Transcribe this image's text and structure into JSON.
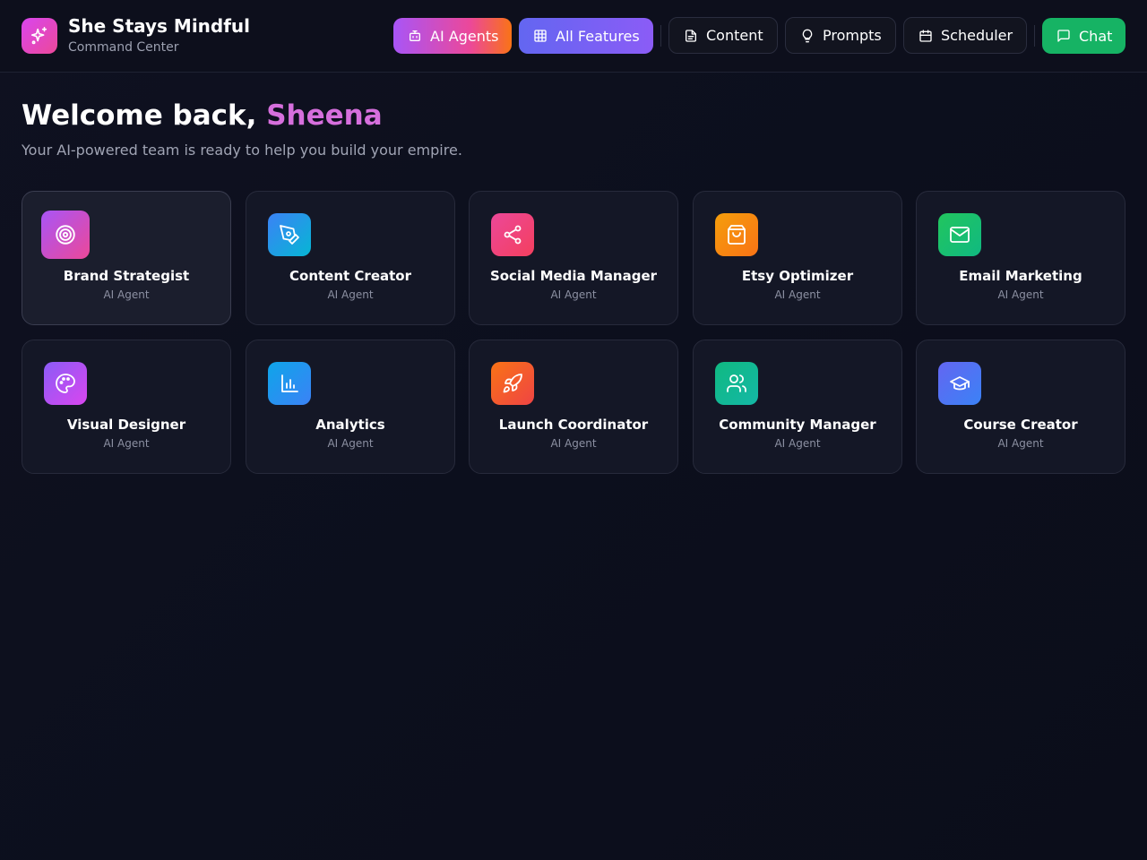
{
  "header": {
    "title": "She Stays Mindful",
    "subtitle": "Command Center",
    "nav": {
      "agents": "AI Agents",
      "features": "All Features",
      "content": "Content",
      "prompts": "Prompts",
      "scheduler": "Scheduler",
      "chat": "Chat"
    }
  },
  "welcome": {
    "greeting": "Welcome back, ",
    "name": "Sheena",
    "subtitle": "Your AI-powered team is ready to help you build your empire."
  },
  "agents": [
    {
      "title": "Brand Strategist",
      "subtitle": "AI Agent",
      "icon": "target-icon",
      "color": "#d946ef"
    },
    {
      "title": "Content Creator",
      "subtitle": "AI Agent",
      "icon": "pen-tool-icon",
      "color": "#3b82f6"
    },
    {
      "title": "Social Media Manager",
      "subtitle": "AI Agent",
      "icon": "share-icon",
      "color": "#ec4899"
    },
    {
      "title": "Etsy Optimizer",
      "subtitle": "AI Agent",
      "icon": "shopping-bag-icon",
      "color": "#f59e0b"
    },
    {
      "title": "Email Marketing",
      "subtitle": "AI Agent",
      "icon": "mail-icon",
      "color": "#22c55e"
    },
    {
      "title": "Visual Designer",
      "subtitle": "AI Agent",
      "icon": "palette-icon",
      "color": "#a855f7"
    },
    {
      "title": "Analytics",
      "subtitle": "AI Agent",
      "icon": "bar-chart-icon",
      "color": "#0ea5e9"
    },
    {
      "title": "Launch Coordinator",
      "subtitle": "AI Agent",
      "icon": "rocket-icon",
      "color": "#f97316"
    },
    {
      "title": "Community Manager",
      "subtitle": "AI Agent",
      "icon": "users-icon",
      "color": "#10b981"
    },
    {
      "title": "Course Creator",
      "subtitle": "AI Agent",
      "icon": "graduation-cap-icon",
      "color": "#6366f1"
    }
  ]
}
